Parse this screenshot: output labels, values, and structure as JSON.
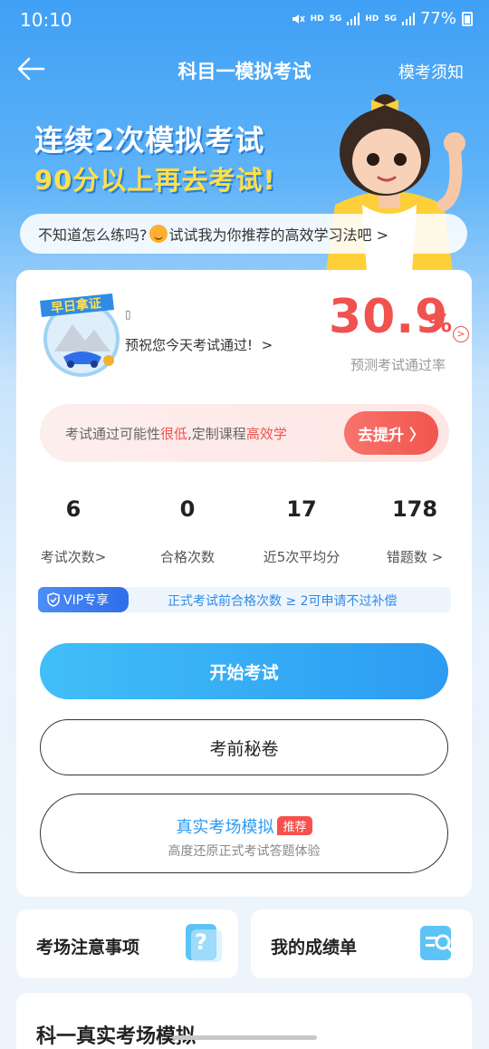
{
  "status_bar": {
    "time": "10:10",
    "hd1": "HD",
    "net1": "5G",
    "hd2": "HD",
    "net2": "5G",
    "battery": "77%"
  },
  "nav": {
    "title": "科目一模拟考试",
    "right_link": "模考须知"
  },
  "banner": {
    "line1": "连续2次模拟考试",
    "line2": "90分以上再去考试!"
  },
  "tip": {
    "text_before": "不知道怎么练吗?",
    "text_after": "试试我为你推荐的高效学习法吧 >"
  },
  "badge": {
    "ribbon": "早日拿证"
  },
  "user": {
    "name": "▯",
    "wish": "预祝您今天考试通过!"
  },
  "pass_rate": {
    "value": "30.9",
    "unit": "%",
    "label": "预测考试通过率"
  },
  "upgrade": {
    "text1": "考试通过可能性",
    "text2": "很低",
    "text3": ",定制课程",
    "text4": "高效学",
    "button": "去提升 〉"
  },
  "stats": [
    {
      "value": "6",
      "label": "考试次数>"
    },
    {
      "value": "0",
      "label": "合格次数"
    },
    {
      "value": "17",
      "label": "近5次平均分"
    },
    {
      "value": "178",
      "label": "错题数 >"
    }
  ],
  "vip": {
    "tag": "VIP专享",
    "text": "正式考试前合格次数 ≥ 2可申请不过补偿"
  },
  "buttons": {
    "start": "开始考试",
    "secret": "考前秘卷",
    "real_title": "真实考场模拟",
    "real_tag": "推荐",
    "real_sub": "高度还原正式考试答题体验"
  },
  "bottom_cards": {
    "notice": "考场注意事项",
    "report": "我的成绩单"
  },
  "partial": {
    "title": "科一真实考场模拟"
  },
  "colors": {
    "accent_blue": "#2c9bf2",
    "accent_red": "#f0524f"
  }
}
